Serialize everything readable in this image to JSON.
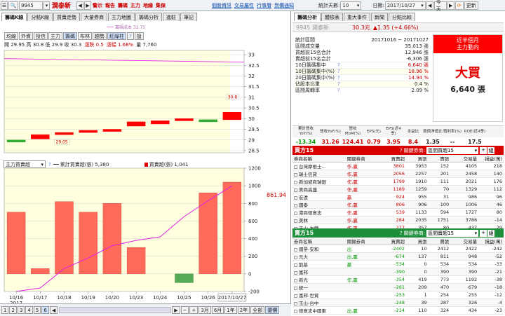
{
  "topbar": {
    "stock_code": "9945",
    "stock_name": "潤泰新",
    "left_buttons": [
      "警示",
      "報告",
      "籌碼",
      "主力",
      "地緣",
      "集保"
    ],
    "links": [
      "個股資訊",
      "交易屬性",
      "行事曆",
      "到價通知"
    ],
    "period_label": "統計天數:",
    "period_value": "10",
    "date_label": "日期:",
    "date_value": "2017/10/27",
    "today_label": "今天",
    "update_label": "更新"
  },
  "left_tabs": [
    "籌碼K線",
    "分點K線",
    "買賣走勢",
    "大量券商",
    "主力地圖",
    "籌碼分析",
    "進駐",
    "筆記"
  ],
  "chart_toolbar": {
    "chips": [
      "均線",
      "外資",
      "投信",
      "主力",
      "籌碼",
      "布林",
      "趨勢",
      "紅綠柱",
      "設"
    ],
    "legend_text": "籌碼成本 32.75",
    "ohlc": "開 29.95  高 30.8  低 29.9  收 30.3",
    "change": "漲跌 0.5",
    "change_pct": "漲幅 1.68%",
    "volume": "量 7,760"
  },
  "price_axis": [
    "33",
    "32.5",
    "32",
    "31.5",
    "31",
    "30.5",
    "30",
    "29.5",
    "29",
    "28.5"
  ],
  "lower_toolbar": {
    "select_value": "主力買賣超",
    "legend1": "累計買賣超(張) 5,380",
    "legend2": "買賣超(張) 1,041",
    "current_value": "861.94"
  },
  "lower_axis": [
    "1200",
    "1000",
    "800",
    "600",
    "400",
    "200",
    "0",
    "-200"
  ],
  "x_dates": [
    "10/16\n2017",
    "10/17",
    "10/18",
    "10/19",
    "10/20",
    "10/23",
    "10/24",
    "10/25",
    "10/26",
    "2017/10/27"
  ],
  "bottom_bar": {
    "pages": [
      "1",
      "2",
      "3",
      "4",
      "5",
      "6"
    ],
    "ranges": [
      "3月",
      "6月",
      "1年",
      "2年",
      "全部",
      "還價"
    ]
  },
  "chart_data": {
    "type": "bar",
    "price_series": {
      "x": [
        "10/16",
        "10/17",
        "10/18",
        "10/19",
        "10/20",
        "10/23",
        "10/24",
        "10/25",
        "10/26",
        "10/27"
      ],
      "open": [
        29.0,
        29.05,
        29.25,
        29.35,
        29.4,
        29.65,
        29.75,
        29.9,
        29.95,
        29.95
      ],
      "close": [
        28.9,
        29.25,
        29.35,
        29.45,
        29.5,
        29.85,
        29.9,
        30.0,
        29.85,
        30.3
      ],
      "annotations": [
        "29.05",
        "30.8"
      ],
      "ylim": [
        28.4,
        33.2
      ]
    },
    "series": [
      {
        "name": "買賣超(張)",
        "values": [
          700,
          60,
          820,
          700,
          800,
          300,
          0,
          -100,
          920,
          1041
        ]
      },
      {
        "name": "累計買賣超(張)",
        "values": [
          -200,
          -160,
          60,
          180,
          320,
          380,
          420,
          650,
          830,
          1000
        ]
      }
    ],
    "ylim": [
      -200,
      1200
    ]
  },
  "right_tabs": [
    "籌碼分析",
    "體檢表",
    "重大事件",
    "新聞",
    "分點比較"
  ],
  "summary": {
    "code_name": "9945 潤泰新",
    "price": "30.3元",
    "change": "▲1.35 (+4.66%)",
    "rows": [
      {
        "label": "統計區間",
        "value": "20171016 ~ 20171027"
      },
      {
        "label": "區間成交量",
        "value": "35,013 張"
      },
      {
        "label": "買超前15名合計",
        "value": "12,946 張"
      },
      {
        "label": "賣超前15名合計",
        "value": "-6,306 張"
      },
      {
        "label": "10日籌碼集中",
        "value": "6,640 張"
      },
      {
        "label": "10日籌碼集中(%)",
        "value": "18.96 %"
      },
      {
        "label": "20日籌碼集中(%)",
        "value": "14.94 %"
      },
      {
        "label": "佔股本比重",
        "value": "0.4 %"
      },
      {
        "label": "區間周轉率",
        "value": "2.09 %"
      }
    ],
    "box_title1": "近半個月",
    "box_title2": "主力動向",
    "box_main": "大買",
    "box_value": "6,640 張"
  },
  "metrics": {
    "headers": [
      "累計營收YoY(%)",
      "營收YoY(%)",
      "營收MoM(%)",
      "EPS(元)",
      "EPS(近4季)",
      "本益比",
      "股價淨值比",
      "殖利率(%)",
      "ROE(近4季)"
    ],
    "values": [
      "-13.34",
      "31.26",
      "124.41",
      "0.79",
      "3.95",
      "8.4",
      "1.35",
      "--",
      "17.5"
    ]
  },
  "buy_table": {
    "title": "買方15",
    "select_label": "關鍵券商:",
    "select_value": "區間買超15",
    "headers": [
      "券商名稱",
      "關鍵券商",
      "買賣超",
      "買張",
      "賣張",
      "交易量",
      "損益(萬)"
    ],
    "rows": [
      [
        "台灣摩根士...",
        "作,贏",
        "3801",
        "3953",
        "152",
        "4105",
        "218"
      ],
      [
        "瑞士信貸",
        "作,贏",
        "2056",
        "2257",
        "201",
        "2458",
        "140"
      ],
      [
        "新加坡商瑞銀",
        "作,贏",
        "1799",
        "1910",
        "111",
        "2021",
        "176"
      ],
      [
        "美商高盛",
        "作,贏",
        "1189",
        "1259",
        "70",
        "1329",
        "112"
      ],
      [
        "宏遠",
        "贏",
        "924",
        "955",
        "31",
        "986",
        "96"
      ],
      [
        "國泰",
        "作,贏",
        "806",
        "906",
        "100",
        "1006",
        "46"
      ],
      [
        "港商德意志",
        "作,贏",
        "539",
        "1133",
        "594",
        "1727",
        "80"
      ],
      [
        "美林",
        "作,贏",
        "284",
        "2035",
        "1751",
        "3786",
        "-14"
      ],
      [
        "玉山-左營",
        "作,贏",
        "277",
        "357",
        "80",
        "437",
        "29"
      ]
    ]
  },
  "sell_table": {
    "title": "賣方15",
    "select_label": "關鍵券商:",
    "select_value": "區間賣超15",
    "headers": [
      "券商名稱",
      "關鍵券商",
      "買賣超",
      "買張",
      "賣張",
      "交易量",
      "損益(萬)"
    ],
    "rows": [
      [
        "國票-安和",
        "出",
        "-2402",
        "10",
        "2412",
        "2422",
        "-242"
      ],
      [
        "元大",
        "出,贏",
        "-674",
        "137",
        "811",
        "948",
        "-52"
      ],
      [
        "凱基",
        "贏",
        "-534",
        "0",
        "534",
        "534",
        "-33"
      ],
      [
        "富邦",
        "",
        "-390",
        "0",
        "390",
        "390",
        "-21"
      ],
      [
        "新光",
        "作,贏",
        "-354",
        "419",
        "773",
        "1192",
        "-38"
      ],
      [
        "統一",
        "",
        "-261",
        "209",
        "470",
        "679",
        "-18"
      ],
      [
        "富邦-世貿",
        "",
        "-253",
        "1",
        "254",
        "255",
        "-12"
      ],
      [
        "玉山-台中",
        "",
        "-248",
        "39",
        "287",
        "326",
        "-4"
      ],
      [
        "德意志中國東",
        "出,贏",
        "-214",
        "110",
        "324",
        "434",
        "-23"
      ]
    ]
  },
  "colors": {
    "up": "#ff0000",
    "down": "#33aa33",
    "bar_fill": "#ff6a5a",
    "cum_line": "#e020e0",
    "highlight_bg": "#ffffe0",
    "accent_red": "#e00000"
  }
}
